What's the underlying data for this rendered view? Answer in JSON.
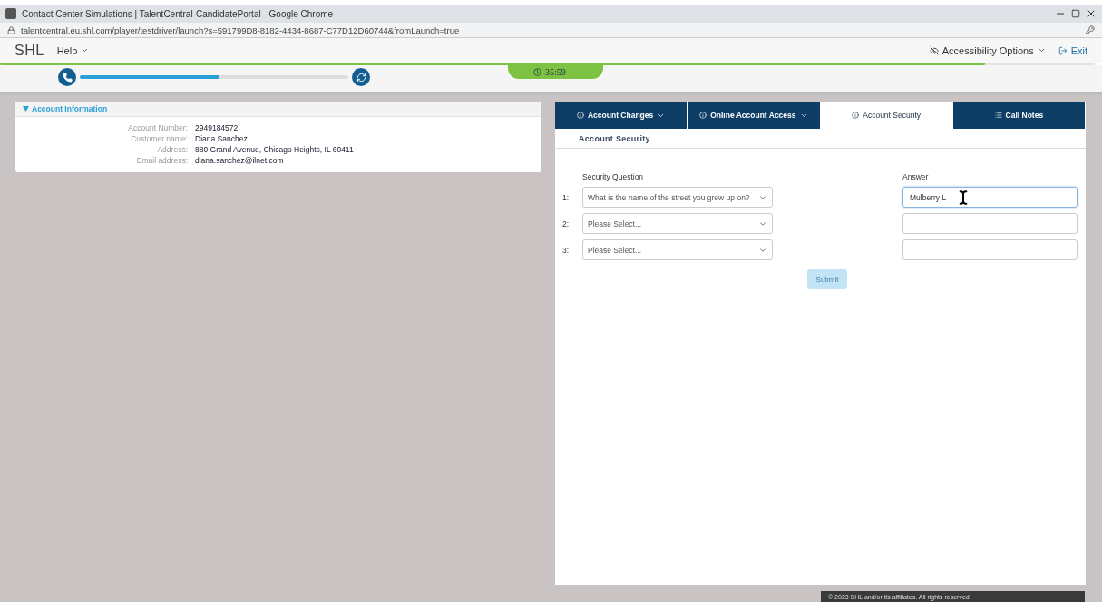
{
  "browser": {
    "title": "Contact Center Simulations | TalentCentral-CandidatePortal - Google Chrome",
    "url": "talentcentral.eu.shl.com/player/testdriver/launch?s=591799D8-8182-4434-8687-C77D12D60744&fromLaunch=true"
  },
  "header": {
    "logo": "SHL",
    "help": "Help",
    "accessibility": "Accessibility Options",
    "exit": "Exit"
  },
  "timer": {
    "time": "35:59",
    "level": 0.9
  },
  "call": {
    "level": 0.52
  },
  "account_info": {
    "title": "Account Information",
    "expanded": true,
    "fields": [
      {
        "label": "Account Number:",
        "value": "2949184572"
      },
      {
        "label": "Customer name:",
        "value": "Diana Sanchez"
      },
      {
        "label": "Address:",
        "value": "880 Grand Avenue, Chicago Heights, IL 60411"
      },
      {
        "label": "Email address:",
        "value": "diana.sanchez@ilnet.com"
      }
    ]
  },
  "tabs": [
    {
      "label": "Account Changes",
      "selected": false,
      "dropdown": true,
      "kind": "info"
    },
    {
      "label": "Online Account Access",
      "selected": false,
      "dropdown": true,
      "kind": "info"
    },
    {
      "label": "Account Security",
      "selected": true,
      "dropdown": false,
      "kind": "info"
    },
    {
      "label": "Call Notes",
      "selected": false,
      "dropdown": false,
      "kind": "notes"
    }
  ],
  "section_title": "Account Security",
  "form": {
    "question_header": "Security Question",
    "answer_header": "Answer",
    "rows": [
      {
        "number": "1:",
        "question": "What is the name of the street you grew up on?",
        "answer": "Mulberry L",
        "focused": true
      },
      {
        "number": "2:",
        "question": "Please Select...",
        "focused": false
      },
      {
        "number": "3:",
        "question": "Please Select...",
        "focused": false
      }
    ],
    "submit": {
      "label": "Submit",
      "disabled": true
    }
  },
  "footer": "© 2023 SHL and/or its affiliates. All rights reserved."
}
